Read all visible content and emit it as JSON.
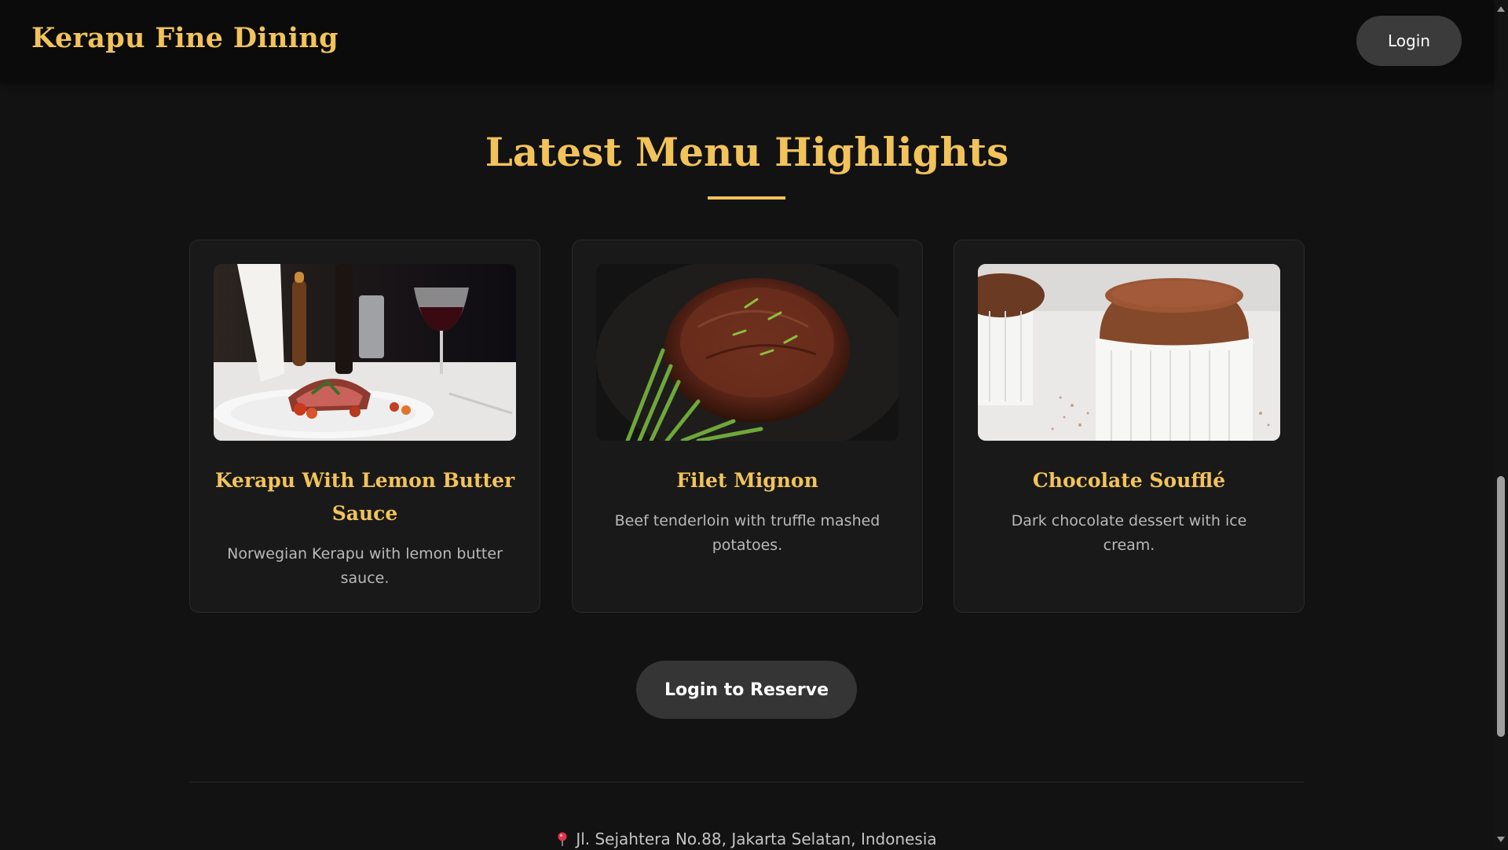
{
  "navbar": {
    "brand": "Kerapu Fine Dining",
    "login_label": "Login"
  },
  "section": {
    "title": "Latest Menu Highlights"
  },
  "menu_items": [
    {
      "name": "Kerapu With Lemon Butter Sauce",
      "description": "Norwegian Kerapu with lemon butter sauce.",
      "image": "plated-fish-dinner-photo"
    },
    {
      "name": "Filet Mignon",
      "description": "Beef tenderloin with truffle mashed potatoes.",
      "image": "seared-steak-photo"
    },
    {
      "name": "Chocolate Soufflé",
      "description": "Dark chocolate dessert with ice cream.",
      "image": "chocolate-souffle-photo"
    }
  ],
  "reserve_label": "Login to Reserve",
  "footer": {
    "address": "Jl. Sejahtera No.88, Jakarta Selatan, Indonesia",
    "address_icon": "map-pin-icon"
  },
  "colors": {
    "accent_gold": "#f2c35a",
    "background": "#121212",
    "card": "#191919",
    "button": "#353535"
  }
}
